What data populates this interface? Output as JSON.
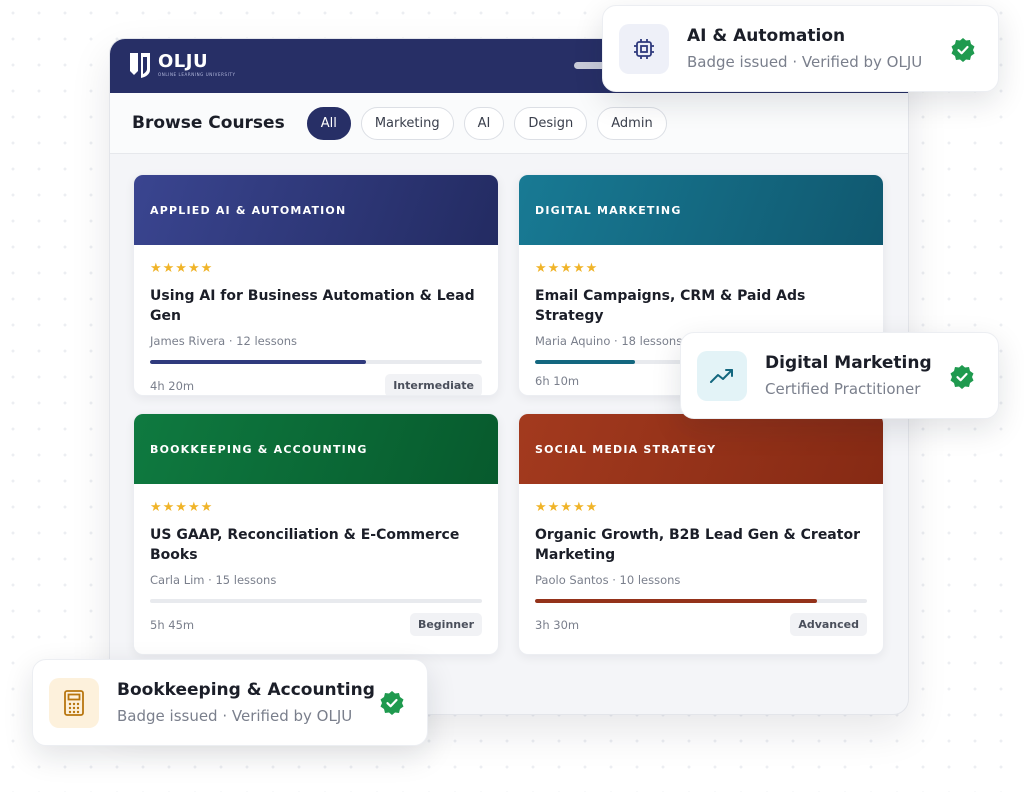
{
  "app": {
    "brand": "OLJU",
    "brand_sub": "ONLINE LEARNING UNIVERSITY"
  },
  "filters": {
    "title": "Browse Courses",
    "chips": [
      "All",
      "Marketing",
      "AI",
      "Design",
      "Admin"
    ],
    "active": "All"
  },
  "courses": [
    {
      "category": "APPLIED AI & AUTOMATION",
      "stars": "★★★★★",
      "title": "Using AI for Business Automation & Lead Gen",
      "meta": "James Rivera · 12 lessons",
      "progress": 0.65,
      "duration": "4h 20m",
      "level": "Intermediate",
      "color": "#2f3a7d",
      "progress_color": "#2f3a7d"
    },
    {
      "category": "DIGITAL MARKETING",
      "stars": "★★★★★",
      "title": "Email Campaigns, CRM & Paid Ads Strategy",
      "meta": "Maria Aquino · 18 lessons",
      "progress": 0.3,
      "duration": "6h 10m",
      "level": "",
      "color": "#13677f",
      "progress_color": "#13677f"
    },
    {
      "category": "BOOKKEEPING & ACCOUNTING",
      "stars": "★★★★★",
      "title": "US GAAP, Reconciliation & E-Commerce Books",
      "meta": "Carla Lim · 15 lessons",
      "progress": 0.0,
      "duration": "5h 45m",
      "level": "Beginner",
      "color": "#0b6a37",
      "progress_color": "#0b6a37"
    },
    {
      "category": "SOCIAL MEDIA STRATEGY",
      "stars": "★★★★★",
      "title": "Organic Growth, B2B Lead Gen & Creator Marketing",
      "meta": "Paolo Santos · 10 lessons",
      "progress": 0.85,
      "duration": "3h 30m",
      "level": "Advanced",
      "color": "#94321a",
      "progress_color": "#94321a"
    }
  ],
  "toasts": [
    {
      "title": "AI & Automation",
      "subtitle": "Badge issued · Verified by OLJU",
      "icon": "chip-icon"
    },
    {
      "title": "Digital Marketing",
      "subtitle": "Certified Practitioner",
      "icon": "trending-up-icon"
    },
    {
      "title": "Bookkeeping & Accounting",
      "subtitle": "Badge issued · Verified by OLJU",
      "icon": "calculator-icon"
    }
  ],
  "colors": {
    "brand": "#272f66",
    "verified": "#1f9a4f",
    "star": "#f0b429"
  }
}
